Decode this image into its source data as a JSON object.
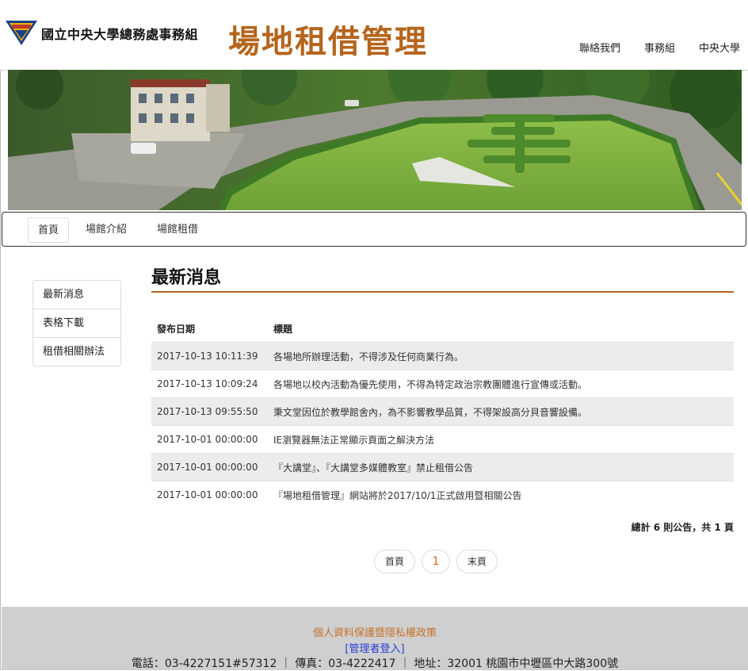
{
  "header": {
    "org_name": "國立中央大學總務處事務組",
    "site_title": "場地租借管理",
    "links": [
      "聯絡我們",
      "事務組",
      "中央大學"
    ]
  },
  "nav": {
    "items": [
      "首頁",
      "場館介紹",
      "場館租借"
    ],
    "active": "首頁"
  },
  "sidebar": {
    "items": [
      "最新消息",
      "表格下載",
      "租借相關辦法"
    ]
  },
  "main": {
    "title": "最新消息",
    "columns": [
      "發布日期",
      "標題"
    ],
    "rows": [
      {
        "date": "2017-10-13 10:11:39",
        "title": "各場地所辦理活動，不得涉及任何商業行為。"
      },
      {
        "date": "2017-10-13 10:09:24",
        "title": "各場地以校內活動為優先使用，不得為特定政治宗教團體進行宣傳或活動。"
      },
      {
        "date": "2017-10-13 09:55:50",
        "title": "秉文堂因位於教學館舍內，為不影響教學品質，不得架設高分貝音響設備。"
      },
      {
        "date": "2017-10-01 00:00:00",
        "title": "IE瀏覽器無法正常顯示頁面之解決方法"
      },
      {
        "date": "2017-10-01 00:00:00",
        "title": "『大講堂』、『大講堂多媒體教室』禁止租借公告"
      },
      {
        "date": "2017-10-01 00:00:00",
        "title": "『場地租借管理』網站將於2017/10/1正式啟用暨相關公告"
      }
    ],
    "summary": "總計 6 則公告，共 1 頁",
    "pager": {
      "first": "首頁",
      "current": "1",
      "last": "末頁"
    }
  },
  "footer": {
    "privacy": "個人資料保護暨隱私權政策",
    "admin_login": "[管理者登入]",
    "contact": "電話：03-4227151#57312 ｜ 傳真：03-4222417 ｜ 地址：32001 桃園市中壢區中大路300號"
  },
  "colors": {
    "brand_orange": "#b5651d",
    "footer_bg": "#cfcfcf",
    "link_blue": "#2a3ed6"
  }
}
